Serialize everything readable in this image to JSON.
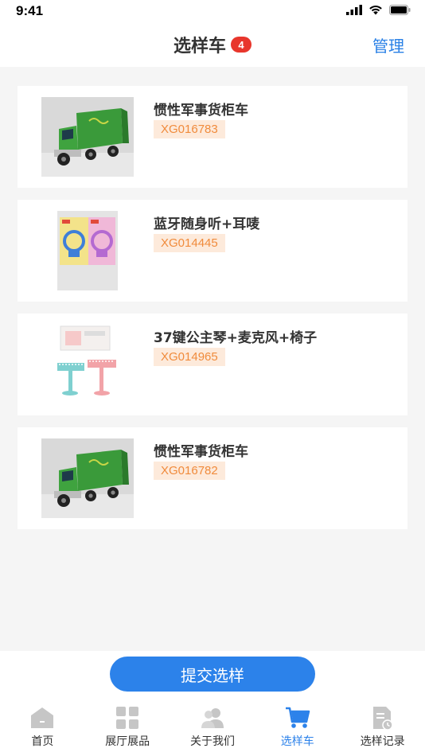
{
  "status": {
    "time": "9:41"
  },
  "nav": {
    "title": "选样车",
    "badge": "4",
    "manage": "管理"
  },
  "items": [
    {
      "name": "惯性军事货柜车",
      "code": "XG016783",
      "thumb": "truck"
    },
    {
      "name": "蓝牙随身听+耳唛",
      "code": "XG014445",
      "thumb": "headset"
    },
    {
      "name": "37键公主琴+麦克风+椅子",
      "code": "XG014965",
      "thumb": "piano"
    },
    {
      "name": "惯性军事货柜车",
      "code": "XG016782",
      "thumb": "truck"
    }
  ],
  "submit": {
    "label": "提交选样"
  },
  "tabs": [
    {
      "label": "首页",
      "icon": "home-icon",
      "active": false
    },
    {
      "label": "展厅展品",
      "icon": "grid-icon",
      "active": false
    },
    {
      "label": "关于我们",
      "icon": "users-icon",
      "active": false
    },
    {
      "label": "选样车",
      "icon": "cart-icon",
      "active": true
    },
    {
      "label": "选样记录",
      "icon": "record-icon",
      "active": false
    }
  ],
  "colors": {
    "accent": "#2c82ea",
    "badge": "#e8362c",
    "code_text": "#f08b3c",
    "code_bg": "#fdeadb"
  }
}
